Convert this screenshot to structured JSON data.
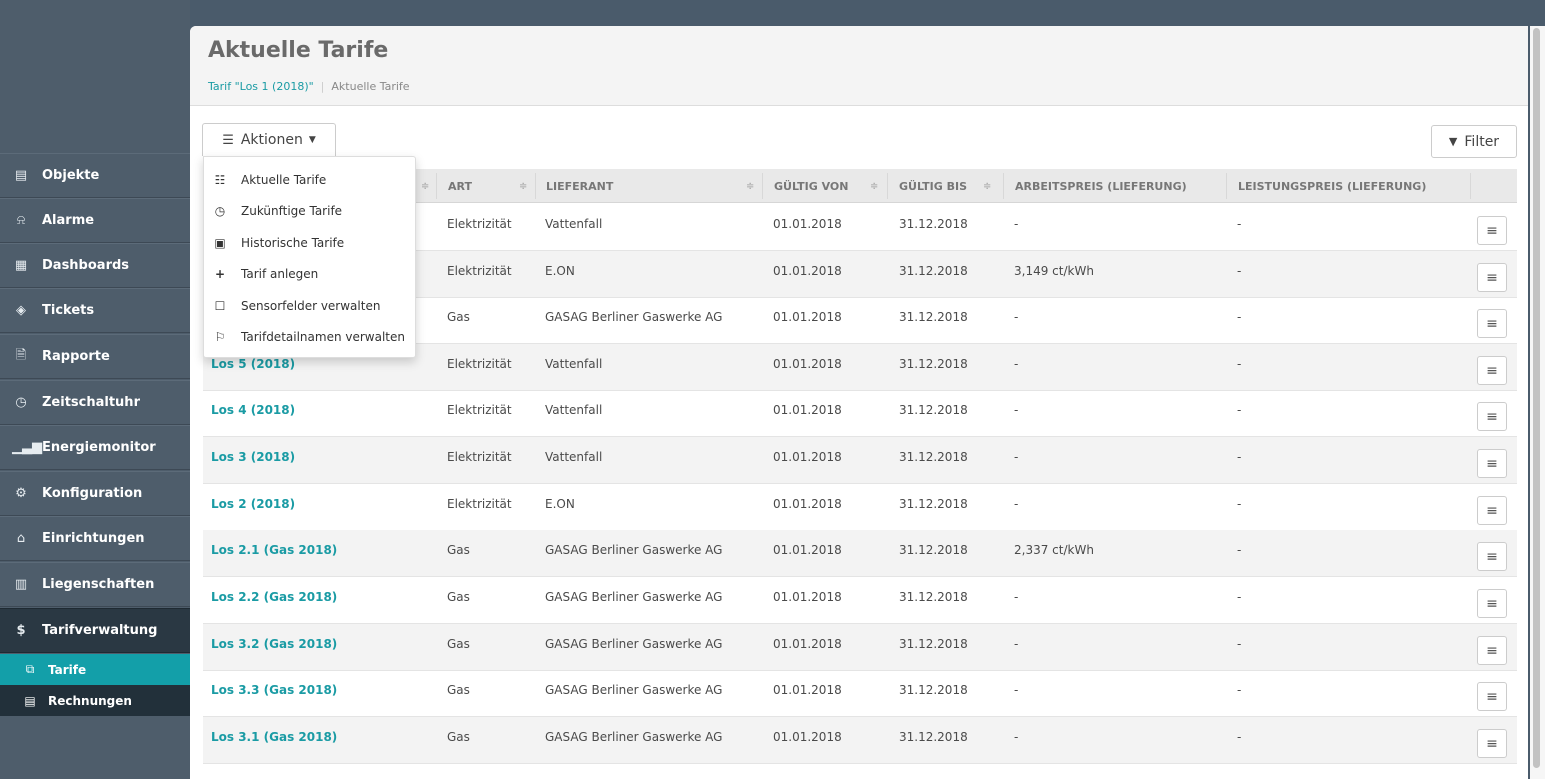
{
  "sidebar": {
    "items": [
      {
        "label": "Objekte",
        "icon": "building-icon"
      },
      {
        "label": "Alarme",
        "icon": "bell-icon"
      },
      {
        "label": "Dashboards",
        "icon": "dashboard-icon"
      },
      {
        "label": "Tickets",
        "icon": "ticket-icon"
      },
      {
        "label": "Rapporte",
        "icon": "report-icon"
      },
      {
        "label": "Zeitschaltuhr",
        "icon": "timer-icon"
      },
      {
        "label": "Energiemonitor",
        "icon": "bar-chart-icon"
      },
      {
        "label": "Konfiguration",
        "icon": "gears-icon"
      },
      {
        "label": "Einrichtungen",
        "icon": "home-icon"
      },
      {
        "label": "Liegenschaften",
        "icon": "buildings-icon"
      },
      {
        "label": "Tarifverwaltung",
        "icon": "dollar-icon"
      }
    ],
    "sub_items": [
      {
        "label": "Tarife",
        "icon": "copy-icon"
      },
      {
        "label": "Rechnungen",
        "icon": "file-icon"
      }
    ]
  },
  "header": {
    "title": "Aktuelle Tarife",
    "breadcrumb_link": "Tarif \"Los 1 (2018)\"",
    "breadcrumb_sep": "|",
    "breadcrumb_current": "Aktuelle Tarife"
  },
  "toolbar": {
    "aktionen_label": "Aktionen",
    "filter_label": "Filter"
  },
  "dropdown": {
    "items": [
      {
        "label": "Aktuelle Tarife",
        "icon": "list-icon"
      },
      {
        "label": "Zukünftige Tarife",
        "icon": "clock-icon"
      },
      {
        "label": "Historische Tarife",
        "icon": "archive-icon"
      },
      {
        "label": "Tarif anlegen",
        "icon": "plus-icon"
      },
      {
        "label": "Sensorfelder verwalten",
        "icon": "checkbox-icon"
      },
      {
        "label": "Tarifdetailnamen verwalten",
        "icon": "bookmark-icon"
      }
    ]
  },
  "table": {
    "columns": [
      "ART",
      "LIEFERANT",
      "GÜLTIG VON",
      "GÜLTIG BIS",
      "ARBEITSPREIS (LIEFERUNG)",
      "LEISTUNGSPREIS (LIEFERUNG)"
    ],
    "rows": [
      {
        "name": "",
        "art": "Elektrizität",
        "lieferant": "Vattenfall",
        "von": "01.01.2018",
        "bis": "31.12.2018",
        "arbeitspreis": "-",
        "leistungspreis": "-"
      },
      {
        "name": "",
        "art": "Elektrizität",
        "lieferant": "E.ON",
        "von": "01.01.2018",
        "bis": "31.12.2018",
        "arbeitspreis": "3,149 ct/kWh",
        "leistungspreis": "-"
      },
      {
        "name": "",
        "art": "Gas",
        "lieferant": "GASAG Berliner Gaswerke AG",
        "von": "01.01.2018",
        "bis": "31.12.2018",
        "arbeitspreis": "-",
        "leistungspreis": "-"
      },
      {
        "name": "Los 5 (2018)",
        "art": "Elektrizität",
        "lieferant": "Vattenfall",
        "von": "01.01.2018",
        "bis": "31.12.2018",
        "arbeitspreis": "-",
        "leistungspreis": "-"
      },
      {
        "name": "Los 4 (2018)",
        "art": "Elektrizität",
        "lieferant": "Vattenfall",
        "von": "01.01.2018",
        "bis": "31.12.2018",
        "arbeitspreis": "-",
        "leistungspreis": "-"
      },
      {
        "name": "Los 3 (2018)",
        "art": "Elektrizität",
        "lieferant": "Vattenfall",
        "von": "01.01.2018",
        "bis": "31.12.2018",
        "arbeitspreis": "-",
        "leistungspreis": "-"
      },
      {
        "name": "Los 2 (2018)",
        "art": "Elektrizität",
        "lieferant": "E.ON",
        "von": "01.01.2018",
        "bis": "31.12.2018",
        "arbeitspreis": "-",
        "leistungspreis": "-"
      },
      {
        "name": "Los 2.1 (Gas 2018)",
        "art": "Gas",
        "lieferant": "GASAG Berliner Gaswerke AG",
        "von": "01.01.2018",
        "bis": "31.12.2018",
        "arbeitspreis": "2,337 ct/kWh",
        "leistungspreis": "-"
      },
      {
        "name": "Los 2.2 (Gas 2018)",
        "art": "Gas",
        "lieferant": "GASAG Berliner Gaswerke AG",
        "von": "01.01.2018",
        "bis": "31.12.2018",
        "arbeitspreis": "-",
        "leistungspreis": "-"
      },
      {
        "name": "Los 3.2 (Gas 2018)",
        "art": "Gas",
        "lieferant": "GASAG Berliner Gaswerke AG",
        "von": "01.01.2018",
        "bis": "31.12.2018",
        "arbeitspreis": "-",
        "leistungspreis": "-"
      },
      {
        "name": "Los 3.3 (Gas 2018)",
        "art": "Gas",
        "lieferant": "GASAG Berliner Gaswerke AG",
        "von": "01.01.2018",
        "bis": "31.12.2018",
        "arbeitspreis": "-",
        "leistungspreis": "-"
      },
      {
        "name": "Los 3.1 (Gas 2018)",
        "art": "Gas",
        "lieferant": "GASAG Berliner Gaswerke AG",
        "von": "01.01.2018",
        "bis": "31.12.2018",
        "arbeitspreis": "-",
        "leistungspreis": "-"
      }
    ]
  },
  "colors": {
    "sidebar": "#4e5d6b",
    "accent": "#1a9ba4",
    "active_sub": "#139fa9"
  }
}
